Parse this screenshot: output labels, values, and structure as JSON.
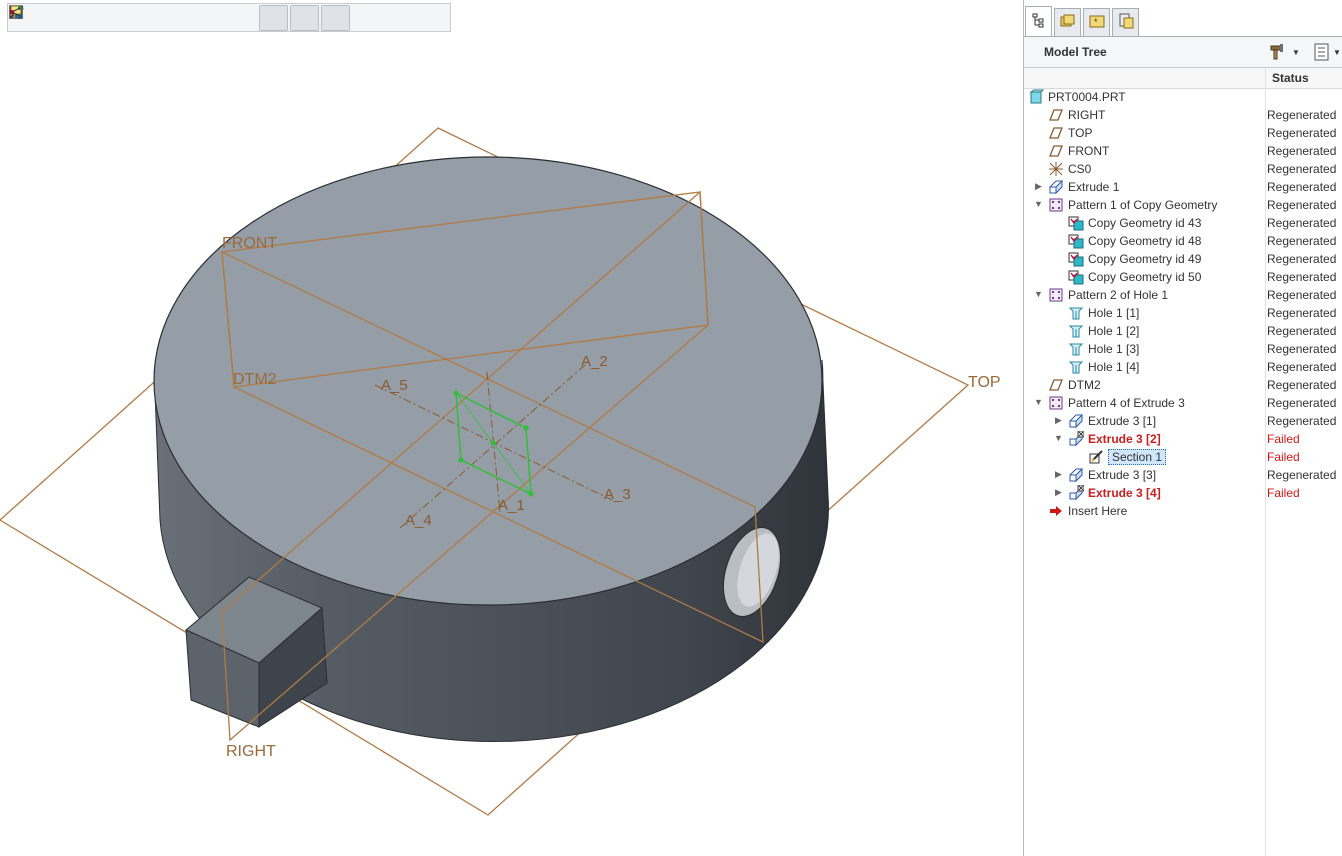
{
  "toolbar": {
    "buttons": [
      {
        "icon": "refit-icon",
        "active": false
      },
      {
        "icon": "zoom-in-icon",
        "active": false
      },
      {
        "icon": "zoom-out-icon",
        "active": false
      },
      {
        "icon": "repaint-icon",
        "active": false
      },
      {
        "icon": "display-style-icon",
        "active": false
      },
      {
        "icon": "saved-orientations-icon",
        "active": false
      },
      {
        "icon": "view-manager-icon",
        "active": false
      },
      {
        "icon": "datum-display-filters-icon",
        "active": false
      },
      {
        "icon": "plane-display-icon",
        "active": true
      },
      {
        "icon": "axis-display-icon",
        "active": true
      },
      {
        "icon": "point-display-icon",
        "active": true
      },
      {
        "icon": "csys-display-icon",
        "active": false
      },
      {
        "icon": "annotation-display-icon",
        "active": false
      },
      {
        "icon": "spin-center-icon",
        "active": false
      }
    ]
  },
  "viewport": {
    "datum_labels": {
      "front": "FRONT",
      "top": "TOP",
      "right": "RIGHT",
      "dtm2": "DTM2"
    },
    "axis_labels": {
      "a1": "A_1",
      "a2": "A_2",
      "a3": "A_3",
      "a4": "A_4",
      "a5": "A_5"
    },
    "colors": {
      "datum_plane": "#b07a45",
      "top_face": "#959ea6",
      "side_face": "#4e555d",
      "sketch": "#2fbf3a"
    }
  },
  "panel": {
    "tabs": [
      {
        "icon": "model-tree-tab-icon",
        "active": true
      },
      {
        "icon": "folder-browser-tab-icon",
        "active": false
      },
      {
        "icon": "favorites-tab-icon",
        "active": false
      },
      {
        "icon": "layers-tab-icon",
        "active": false
      }
    ],
    "title": "Model Tree",
    "status_header": "Status",
    "colors": {
      "failed": "#d01818",
      "selected_bg": "#cfe6fb"
    },
    "rows": [
      {
        "indent": 0,
        "toggle": "",
        "icon": "part-icon",
        "label": "PRT0004.PRT",
        "status": "",
        "failed": false,
        "selected": false
      },
      {
        "indent": 1,
        "toggle": "",
        "icon": "datum-plane-icon",
        "label": "RIGHT",
        "status": "Regenerated",
        "failed": false,
        "selected": false
      },
      {
        "indent": 1,
        "toggle": "",
        "icon": "datum-plane-icon",
        "label": "TOP",
        "status": "Regenerated",
        "failed": false,
        "selected": false
      },
      {
        "indent": 1,
        "toggle": "",
        "icon": "datum-plane-icon",
        "label": "FRONT",
        "status": "Regenerated",
        "failed": false,
        "selected": false
      },
      {
        "indent": 1,
        "toggle": "",
        "icon": "csys-icon",
        "label": "CS0",
        "status": "Regenerated",
        "failed": false,
        "selected": false
      },
      {
        "indent": 1,
        "toggle": "▶",
        "icon": "extrude-icon",
        "label": "Extrude 1",
        "status": "Regenerated",
        "failed": false,
        "selected": false
      },
      {
        "indent": 1,
        "toggle": "▼",
        "icon": "pattern-icon",
        "label": "Pattern 1 of Copy Geometry",
        "status": "Regenerated",
        "failed": false,
        "selected": false
      },
      {
        "indent": 2,
        "toggle": "",
        "icon": "copy-geometry-icon",
        "label": "Copy Geometry id 43",
        "status": "Regenerated",
        "failed": false,
        "selected": false
      },
      {
        "indent": 2,
        "toggle": "",
        "icon": "copy-geometry-icon",
        "label": "Copy Geometry id 48",
        "status": "Regenerated",
        "failed": false,
        "selected": false
      },
      {
        "indent": 2,
        "toggle": "",
        "icon": "copy-geometry-icon",
        "label": "Copy Geometry id 49",
        "status": "Regenerated",
        "failed": false,
        "selected": false
      },
      {
        "indent": 2,
        "toggle": "",
        "icon": "copy-geometry-icon",
        "label": "Copy Geometry id 50",
        "status": "Regenerated",
        "failed": false,
        "selected": false
      },
      {
        "indent": 1,
        "toggle": "▼",
        "icon": "pattern-icon",
        "label": "Pattern 2 of Hole 1",
        "status": "Regenerated",
        "failed": false,
        "selected": false
      },
      {
        "indent": 2,
        "toggle": "",
        "icon": "hole-icon",
        "label": "Hole 1 [1]",
        "status": "Regenerated",
        "failed": false,
        "selected": false
      },
      {
        "indent": 2,
        "toggle": "",
        "icon": "hole-icon",
        "label": "Hole 1 [2]",
        "status": "Regenerated",
        "failed": false,
        "selected": false
      },
      {
        "indent": 2,
        "toggle": "",
        "icon": "hole-icon",
        "label": "Hole 1 [3]",
        "status": "Regenerated",
        "failed": false,
        "selected": false
      },
      {
        "indent": 2,
        "toggle": "",
        "icon": "hole-icon",
        "label": "Hole 1 [4]",
        "status": "Regenerated",
        "failed": false,
        "selected": false
      },
      {
        "indent": 1,
        "toggle": "",
        "icon": "datum-plane-icon",
        "label": "DTM2",
        "status": "Regenerated",
        "failed": false,
        "selected": false
      },
      {
        "indent": 1,
        "toggle": "▼",
        "icon": "pattern-icon",
        "label": "Pattern 4 of Extrude 3",
        "status": "Regenerated",
        "failed": false,
        "selected": false
      },
      {
        "indent": 2,
        "toggle": "▶",
        "icon": "extrude-icon",
        "label": "Extrude 3 [1]",
        "status": "Regenerated",
        "failed": false,
        "selected": false
      },
      {
        "indent": 2,
        "toggle": "▼",
        "icon": "extrude-failed-icon",
        "label": "Extrude 3 [2]",
        "status": "Failed",
        "failed": true,
        "selected": false
      },
      {
        "indent": 3,
        "toggle": "",
        "icon": "section-sketch-icon",
        "label": "Section 1",
        "status": "Failed",
        "failed": false,
        "selected": true
      },
      {
        "indent": 2,
        "toggle": "▶",
        "icon": "extrude-icon",
        "label": "Extrude 3 [3]",
        "status": "Regenerated",
        "failed": false,
        "selected": false
      },
      {
        "indent": 2,
        "toggle": "▶",
        "icon": "extrude-failed-icon",
        "label": "Extrude 3 [4]",
        "status": "Failed",
        "failed": true,
        "selected": false
      },
      {
        "indent": 1,
        "toggle": "",
        "icon": "insert-here-arrow-icon",
        "label": "Insert Here",
        "status": "",
        "failed": false,
        "selected": false
      }
    ]
  }
}
